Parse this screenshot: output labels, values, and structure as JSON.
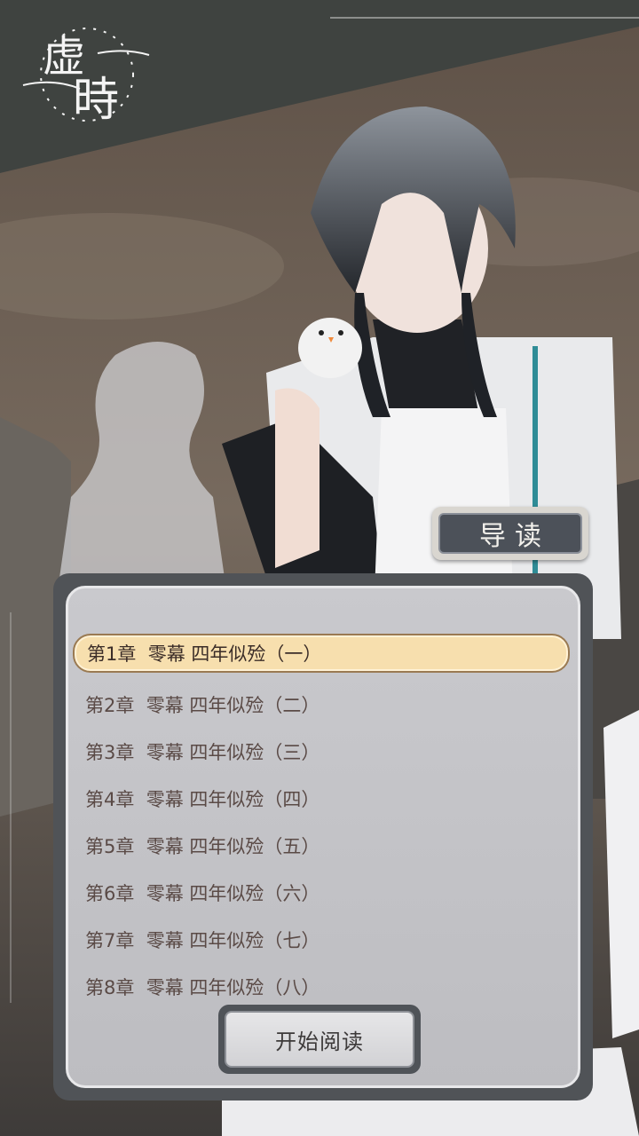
{
  "app": {
    "logo_text": "虚時",
    "colors": {
      "accent": "#f7dfae",
      "panel": "#505357",
      "guide_button": "#4c5159"
    }
  },
  "guide_button": {
    "label": "导读",
    "icon": "none"
  },
  "chapters": [
    {
      "label": "第1章  零幕 四年似殓（一）",
      "selected": true
    },
    {
      "label": "第2章  零幕 四年似殓（二）",
      "selected": false
    },
    {
      "label": "第3章  零幕 四年似殓（三）",
      "selected": false
    },
    {
      "label": "第4章  零幕 四年似殓（四）",
      "selected": false
    },
    {
      "label": "第5章  零幕 四年似殓（五）",
      "selected": false
    },
    {
      "label": "第6章  零幕 四年似殓（六）",
      "selected": false
    },
    {
      "label": "第7章  零幕 四年似殓（七）",
      "selected": false
    },
    {
      "label": "第8章  零幕 四年似殓（八）",
      "selected": false
    }
  ],
  "start_button": {
    "label": "开始阅读"
  }
}
